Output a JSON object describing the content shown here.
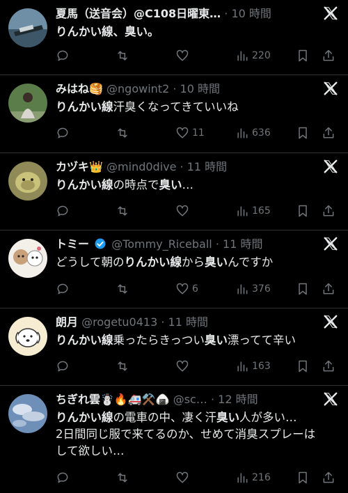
{
  "tweets": [
    {
      "name": "夏馬（送音会）@C108日曜東…",
      "handle": "",
      "time": "10 時間",
      "body_parts": [
        {
          "text": "りんかい線、臭い。",
          "bold": true
        }
      ],
      "replies": "",
      "retweets": "",
      "likes": "",
      "views": "220",
      "avatar_icon": "ship-photo-avatar"
    },
    {
      "name": "みはね🥞",
      "handle": "@ngowint2",
      "time": "10 時間",
      "body_parts": [
        {
          "text": "りんかい線",
          "bold": true
        },
        {
          "text": "汗臭くなってきていいね",
          "bold": false
        }
      ],
      "replies": "",
      "retweets": "",
      "likes": "11",
      "views": "636",
      "avatar_icon": "person-photo-avatar"
    },
    {
      "name": "カヅキ👑",
      "handle": "@mind0dive",
      "time": "11 時間",
      "body_parts": [
        {
          "text": "りんかい線",
          "bold": true
        },
        {
          "text": "の時点で",
          "bold": false
        },
        {
          "text": "臭い",
          "bold": true
        },
        {
          "text": "…",
          "bold": false
        }
      ],
      "replies": "",
      "retweets": "",
      "likes": "",
      "views": "165",
      "avatar_icon": "animal-photo-avatar"
    },
    {
      "name": "トミー",
      "handle": "@Tommy_Riceball",
      "time": "11 時間",
      "body_parts": [
        {
          "text": "どうして朝の",
          "bold": false
        },
        {
          "text": "りんかい線",
          "bold": true
        },
        {
          "text": "から",
          "bold": false
        },
        {
          "text": "臭い",
          "bold": true
        },
        {
          "text": "んですか",
          "bold": false
        }
      ],
      "replies": "",
      "retweets": "",
      "likes": "6",
      "views": "376",
      "avatar_icon": "illustration-avatar",
      "verified": true
    },
    {
      "name": "朗月",
      "handle": "@rogetu0413",
      "time": "11 時間",
      "body_parts": [
        {
          "text": "りんかい線",
          "bold": true
        },
        {
          "text": "乗ったらきっつい",
          "bold": false
        },
        {
          "text": "臭い",
          "bold": true
        },
        {
          "text": "漂ってて辛い",
          "bold": false
        }
      ],
      "replies": "",
      "retweets": "",
      "likes": "",
      "views": "163",
      "avatar_icon": "dog-illustration-avatar"
    },
    {
      "name": "ちぎれ雲☃️🔥🚑⚒️🍙",
      "handle": "@sc…",
      "time": "12 時間",
      "body_parts": [
        {
          "text": "りんかい線",
          "bold": true
        },
        {
          "text": "の電車の中、凄く汗",
          "bold": false
        },
        {
          "text": "臭い",
          "bold": true
        },
        {
          "text": "人が多い…\n2日間同じ服で来てるのか、せめて消臭スプレーは\nして欲しい…",
          "bold": false
        }
      ],
      "replies": "",
      "retweets": "",
      "likes": "",
      "views": "216",
      "avatar_icon": "sky-photo-avatar"
    }
  ],
  "separator": "·",
  "icons": {
    "platform": "x-logo-icon",
    "reply": "reply-icon",
    "retweet": "retweet-icon",
    "like": "heart-icon",
    "views": "views-chart-icon",
    "bookmark": "bookmark-icon",
    "share": "share-icon"
  },
  "colors": {
    "background": "#000000",
    "text": "#e7e9ea",
    "muted": "#71767b",
    "divider": "#2f3336",
    "verified": "#1d9bf0"
  }
}
